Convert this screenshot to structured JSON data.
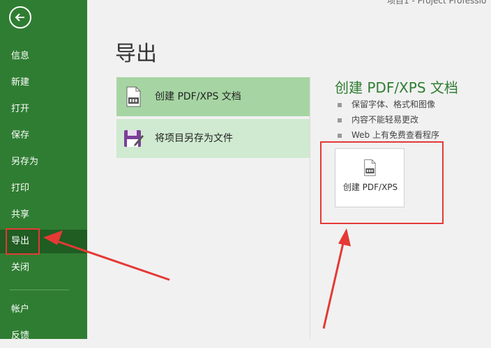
{
  "window": {
    "title": "项目1  -  Project Professio"
  },
  "sidebar": {
    "items": [
      {
        "label": "信息"
      },
      {
        "label": "新建"
      },
      {
        "label": "打开"
      },
      {
        "label": "保存"
      },
      {
        "label": "另存为"
      },
      {
        "label": "打印"
      },
      {
        "label": "共享"
      },
      {
        "label": "导出"
      },
      {
        "label": "关闭"
      },
      {
        "label": "帐户"
      },
      {
        "label": "反馈"
      }
    ],
    "accent": "#2f7d32",
    "active_index": 7
  },
  "main": {
    "title": "导出",
    "options": [
      {
        "label": "创建 PDF/XPS 文档",
        "icon": "pdf-document-icon"
      },
      {
        "label": "将项目另存为文件",
        "icon": "save-as-file-icon"
      }
    ],
    "detail": {
      "title": "创建 PDF/XPS 文档",
      "bullets": [
        "保留字体、格式和图像",
        "内容不能轻易更改",
        "Web 上有免费查看程序"
      ],
      "button_label": "创建 PDF/XPS",
      "button_icon": "pdf-document-icon"
    }
  },
  "colors": {
    "highlight": "#e53935",
    "selected_option": "#a6d5a3",
    "option": "#cfead0"
  }
}
